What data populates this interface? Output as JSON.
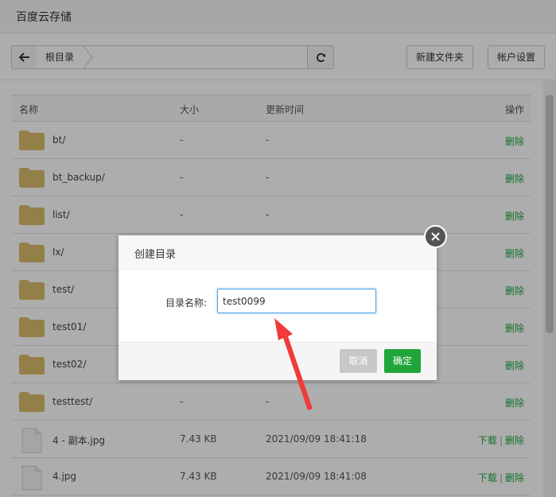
{
  "window": {
    "title": "百度云存储"
  },
  "toolbar": {
    "breadcrumb": "根目录",
    "new_folder": "新建文件夹",
    "account_settings": "帐户设置"
  },
  "table": {
    "headers": {
      "name": "名称",
      "size": "大小",
      "time": "更新时间",
      "ops": "操作"
    },
    "rows": [
      {
        "type": "folder",
        "name": "bt/",
        "size": "-",
        "time": "-",
        "ops": [
          "删除"
        ]
      },
      {
        "type": "folder",
        "name": "bt_backup/",
        "size": "-",
        "time": "-",
        "ops": [
          "删除"
        ]
      },
      {
        "type": "folder",
        "name": "list/",
        "size": "-",
        "time": "-",
        "ops": [
          "删除"
        ]
      },
      {
        "type": "folder",
        "name": "lx/",
        "size": "",
        "time": "",
        "ops": [
          "删除"
        ]
      },
      {
        "type": "folder",
        "name": "test/",
        "size": "",
        "time": "",
        "ops": [
          "删除"
        ]
      },
      {
        "type": "folder",
        "name": "test01/",
        "size": "",
        "time": "",
        "ops": [
          "删除"
        ]
      },
      {
        "type": "folder",
        "name": "test02/",
        "size": "",
        "time": "",
        "ops": [
          "删除"
        ]
      },
      {
        "type": "folder",
        "name": "testtest/",
        "size": "-",
        "time": "-",
        "ops": [
          "删除"
        ]
      },
      {
        "type": "file",
        "name": "4 - 副本.jpg",
        "size": "7.43 KB",
        "time": "2021/09/09 18:41:18",
        "ops": [
          "下载",
          "删除"
        ]
      },
      {
        "type": "file",
        "name": "4.jpg",
        "size": "7.43 KB",
        "time": "2021/09/09 18:41:08",
        "ops": [
          "下载",
          "删除"
        ]
      }
    ]
  },
  "dialog": {
    "title": "创建目录",
    "label": "目录名称:",
    "input_value": "test0099",
    "cancel": "取消",
    "confirm": "确定"
  },
  "colors": {
    "accent_green": "#20a53a",
    "folder": "#d9bd6a",
    "annotation_arrow": "#f23a3a",
    "input_focus": "#4aa3e8"
  }
}
